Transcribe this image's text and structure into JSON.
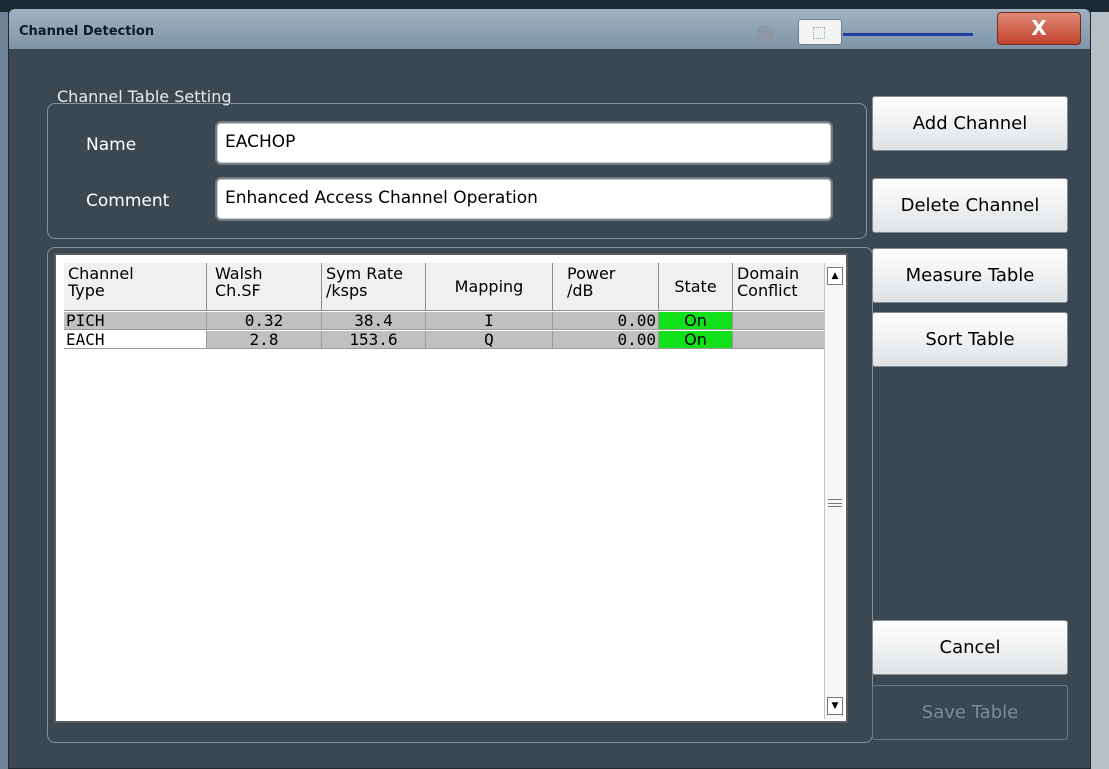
{
  "window": {
    "title": "Channel Detection",
    "close_label": "X"
  },
  "settings": {
    "group_label": "Channel Table Setting",
    "name_label": "Name",
    "name_value": "EACHOP",
    "comment_label": "Comment",
    "comment_value": "Enhanced Access Channel Operation"
  },
  "table": {
    "headers": [
      [
        "Channel",
        "Type"
      ],
      [
        "Walsh",
        "Ch.SF"
      ],
      [
        "Sym Rate",
        "/ksps"
      ],
      [
        "Mapping"
      ],
      [
        "Power",
        "/dB"
      ],
      [
        "State"
      ],
      [
        "Domain",
        "Conflict"
      ]
    ],
    "rows": [
      {
        "type": "PICH",
        "walsh": "0.32",
        "symrate": "38.4",
        "mapping": "I",
        "power": "0.00",
        "state": "On",
        "conflict": ""
      },
      {
        "type": "EACH",
        "walsh": "2.8",
        "symrate": "153.6",
        "mapping": "Q",
        "power": "0.00",
        "state": "On",
        "conflict": ""
      }
    ],
    "state_on_color": "#11e01a",
    "row_color": "#c0c0c0"
  },
  "buttons": {
    "add_channel": "Add Channel",
    "delete_channel": "Delete Channel",
    "measure_table": "Measure Table",
    "sort_table": "Sort Table",
    "cancel": "Cancel",
    "save_table": "Save Table"
  },
  "colors": {
    "close_button": "#c3432d",
    "dialog_bg": "#3b4751"
  }
}
